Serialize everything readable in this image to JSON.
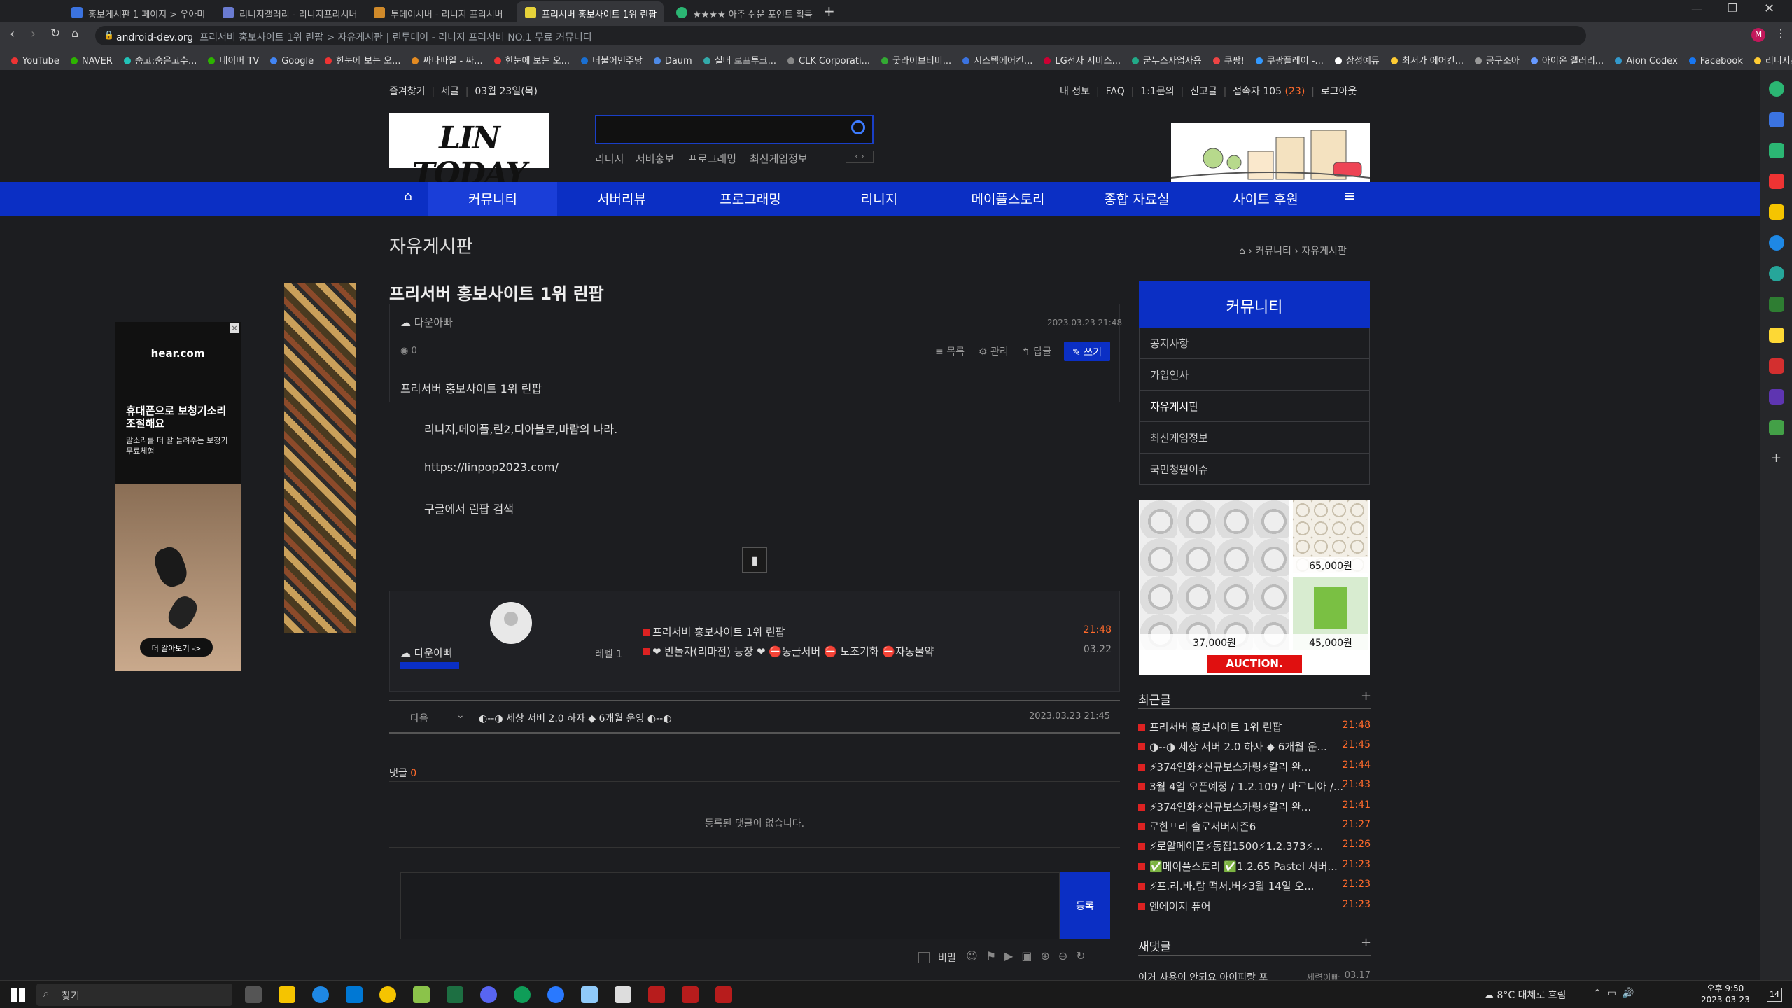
{
  "browser": {
    "tabs": [
      {
        "label": "홍보게시판 1 페이지 > 우아미",
        "color": "#3b73e0"
      },
      {
        "label": "리니지갤러리 - 리니지프리서버",
        "color": "#6a7bd1"
      },
      {
        "label": "투데이서버 - 리니지 프리서버",
        "color": "#d08a2a"
      },
      {
        "label": "프리서버 홍보사이트 1위 린팝",
        "color": "#e6d23a"
      },
      {
        "label": "★★★★ 아주 쉬운 포인트 획득",
        "color": "#2bb673"
      }
    ],
    "address_domain": "android-dev.org",
    "address_title": "프리서버 홍보사이트 1위 린팝 > 자유게시판 | 린투데이 - 리니지 프리서버 NO.1 무료 커뮤니티",
    "bookmarks": [
      {
        "label": "YouTube",
        "color": "#e33"
      },
      {
        "label": "NAVER",
        "color": "#2db400"
      },
      {
        "label": "숨고:숨은고수...",
        "color": "#22c3b8"
      },
      {
        "label": "네이버 TV",
        "color": "#2db400"
      },
      {
        "label": "Google",
        "color": "#4285f4"
      },
      {
        "label": "한눈에 보는 오...",
        "color": "#e33"
      },
      {
        "label": "싸다파일 - 싸...",
        "color": "#e38b22"
      },
      {
        "label": "한눈에 보는 오...",
        "color": "#e33"
      },
      {
        "label": "더불어민주당",
        "color": "#1a6fd1"
      },
      {
        "label": "Daum",
        "color": "#4e8ae6"
      },
      {
        "label": "실버 로프투크...",
        "color": "#3aa"
      },
      {
        "label": "CLK Corporati...",
        "color": "#888"
      },
      {
        "label": "굿라이브티비...",
        "color": "#3a3"
      },
      {
        "label": "시스템에어컨...",
        "color": "#3b73e0"
      },
      {
        "label": "LG전자 서비스...",
        "color": "#c03"
      },
      {
        "label": "굳누스사업자용",
        "color": "#2a8"
      },
      {
        "label": "쿠팡!",
        "color": "#e44"
      },
      {
        "label": "쿠팡플레이 -...",
        "color": "#39f"
      },
      {
        "label": "삼성예듀",
        "color": "#fff"
      },
      {
        "label": "최저가 에어컨...",
        "color": "#fc3"
      },
      {
        "label": "공구조아",
        "color": "#999"
      },
      {
        "label": "아이온 갤러리...",
        "color": "#69f"
      },
      {
        "label": "Aion Codex",
        "color": "#39c"
      },
      {
        "label": "Facebook",
        "color": "#1877f2"
      },
      {
        "label": "리니지홍보",
        "color": "#fc3"
      }
    ],
    "colors": {
      "accent": "#0b2fc4",
      "time": "#ff6a2b"
    }
  },
  "site": {
    "top_left": [
      "즐겨찾기",
      "세글",
      "03월 23일(목)"
    ],
    "top_right": [
      "내 정보",
      "FAQ",
      "1:1문의",
      "신고글"
    ],
    "visitors_label": "접속자 105",
    "visitors_new": "(23)",
    "logout": "로그아웃",
    "logo": "LIN TODAY",
    "quick_links": [
      "리니지",
      "서버홍보",
      "프로그래밍",
      "최신게임정보"
    ],
    "nav": [
      "커뮤니티",
      "서버리뷰",
      "프로그래밍",
      "리니지",
      "메이플스토리",
      "종합 자료실",
      "사이트 후원"
    ],
    "board_title": "자유게시판",
    "breadcrumb": [
      "커뮤니티",
      "자유게시판"
    ]
  },
  "post": {
    "title": "프리서버 홍보사이트 1위 린팝",
    "author": "다운아빠",
    "date": "2023.03.23 21:48",
    "views": "0",
    "actions": {
      "list": "목록",
      "manage": "관리",
      "reply": "답글",
      "write": "쓰기"
    },
    "body": [
      "프리서버 홍보사이트 1위 린팝",
      "리니지,메이플,린2,디아블로,바람의 나라.",
      "https://linpop2023.com/",
      "구글에서 린팝 검색"
    ],
    "author_box": {
      "name": "다운아빠",
      "level": "레벨 1",
      "posts": [
        {
          "title": "프리서버 홍보사이트 1위 린팝",
          "time": "21:48"
        },
        {
          "title": "❤ 반놀자(리마전) 등장 ❤ ⛔동글서버 ⛔ 노조기화 ⛔자동물약",
          "time": "03.22"
        }
      ]
    },
    "next": {
      "label": "다음",
      "title": "◐--◑ 세상 서버 2.0 하자 ◆ 6개월 운영 ◐--◐",
      "date": "2023.03.23 21:45"
    },
    "comments_label": "댓글",
    "comments_count": "0",
    "no_comments": "등록된 댓글이 없습니다.",
    "submit": "등록",
    "secret": "비밀"
  },
  "ad": {
    "brand": "hear.com",
    "headline": "휴대폰으로 보청기소리 조절해요",
    "sub": "말소리를 더 잘 들려주는 보청기 무료체험",
    "cta": "더 알아보기 ->"
  },
  "sidebar": {
    "title": "커뮤니티",
    "links": [
      "공지사항",
      "가입인사",
      "자유게시판",
      "최신게임정보",
      "국민청원이슈"
    ],
    "prices": [
      "65,000원",
      "37,000원",
      "45,000원"
    ],
    "auction": "AUCTION.",
    "latest_title": "최근글",
    "latest": [
      {
        "title": "프리서버 홍보사이트 1위 린팝",
        "time": "21:48"
      },
      {
        "title": "◑--◑ 세상 서버 2.0 하자 ◆ 6개월 운...",
        "time": "21:45"
      },
      {
        "title": "⚡374연화⚡신규보스카링⚡칼리 완...",
        "time": "21:44"
      },
      {
        "title": "3월 4일 오픈예정 / 1.2.109 / 마르디아 /...",
        "time": "21:43"
      },
      {
        "title": "⚡374연화⚡신규보스카링⚡칼리 완...",
        "time": "21:41"
      },
      {
        "title": "로한프리 솔로서버시즌6",
        "time": "21:27"
      },
      {
        "title": "⚡로알메이플⚡동접1500⚡1.2.373⚡...",
        "time": "21:26"
      },
      {
        "title": "✅메이플스토리 ✅1.2.65 Pastel 서버...",
        "time": "21:23"
      },
      {
        "title": "⚡프.리.바.람 떡서.버⚡3월 14일 오...",
        "time": "21:23"
      },
      {
        "title": "엔에이지 퓨어",
        "time": "21:23"
      }
    ],
    "comments_title": "새댓글",
    "comment_preview": "이거 사용이 안되요 아이피랑 포",
    "comment_author": "세렴아빠",
    "comment_date": "03.17"
  },
  "taskbar": {
    "search": "찾기",
    "weather": "8°C 대체로 흐림",
    "time": "오후 9:50",
    "date": "2023-03-23",
    "badge": "14"
  }
}
